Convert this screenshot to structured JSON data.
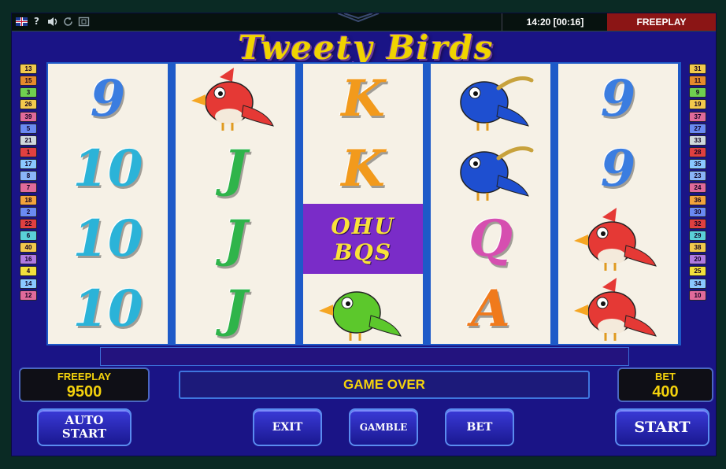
{
  "topbar": {
    "help": "?",
    "sound_icon": "speaker-icon",
    "reload_icon": "reload-icon",
    "fullscreen_icon": "fullscreen-icon",
    "clock": "14:20 [00:16]",
    "mode": "FREEPLAY"
  },
  "game": {
    "title": "Tweety Birds"
  },
  "paylines": {
    "left": [
      "13",
      "15",
      "3",
      "26",
      "39",
      "5",
      "21",
      "1",
      "17",
      "8",
      "7",
      "18",
      "2",
      "22",
      "6",
      "40",
      "16",
      "4",
      "14",
      "12"
    ],
    "right": [
      "31",
      "11",
      "9",
      "19",
      "37",
      "27",
      "33",
      "28",
      "35",
      "23",
      "24",
      "36",
      "30",
      "32",
      "29",
      "38",
      "20",
      "25",
      "34",
      "10"
    ],
    "colors": [
      "#f2c94c",
      "#e58a2c",
      "#6fcf4f",
      "#f2c94c",
      "#e06a9a",
      "#6a8af2",
      "#cfd8dc",
      "#e04040",
      "#8ac8ff",
      "#8ab4f8",
      "#e06a9a",
      "#f2a23c",
      "#6a8af2",
      "#e04040",
      "#5ad0d8",
      "#f2c94c",
      "#b07ae0",
      "#f2e03c",
      "#8ac8ff",
      "#e06a9a"
    ]
  },
  "reels": [
    [
      {
        "sym": "9",
        "color": "#3b7de0"
      },
      {
        "sym": "10",
        "color": "#2bb3d8"
      },
      {
        "sym": "10",
        "color": "#2bb3d8"
      },
      {
        "sym": "10",
        "color": "#2bb3d8"
      }
    ],
    [
      {
        "sym": "red-bird",
        "color": "#e53935"
      },
      {
        "sym": "J",
        "color": "#2fb44a"
      },
      {
        "sym": "J",
        "color": "#2fb44a"
      },
      {
        "sym": "J",
        "color": "#2fb44a"
      }
    ],
    [
      {
        "sym": "K",
        "color": "#f29a1c"
      },
      {
        "sym": "K",
        "color": "#f29a1c"
      },
      {
        "sym": "bonus",
        "color": "#7a2cc8"
      },
      {
        "sym": "green-bird",
        "color": "#5cc82c"
      }
    ],
    [
      {
        "sym": "blue-bird",
        "color": "#1e4fd0"
      },
      {
        "sym": "blue-bird",
        "color": "#1e4fd0"
      },
      {
        "sym": "Q",
        "color": "#d64fb0"
      },
      {
        "sym": "A",
        "color": "#f07a1c"
      }
    ],
    [
      {
        "sym": "9",
        "color": "#3b7de0"
      },
      {
        "sym": "9",
        "color": "#3b7de0"
      },
      {
        "sym": "red-bird",
        "color": "#e53935"
      },
      {
        "sym": "red-bird",
        "color": "#e53935"
      }
    ]
  ],
  "bonus_lines": [
    "OHU",
    "BQS"
  ],
  "freeplay": {
    "label": "FREEPLAY",
    "value": "9500"
  },
  "message": "GAME OVER",
  "bet": {
    "label": "BET",
    "value": "400"
  },
  "buttons": {
    "auto_start": "AUTO\nSTART",
    "exit": "EXIT",
    "gamble": "GAMBLE",
    "bet": "BET",
    "start": "START"
  }
}
